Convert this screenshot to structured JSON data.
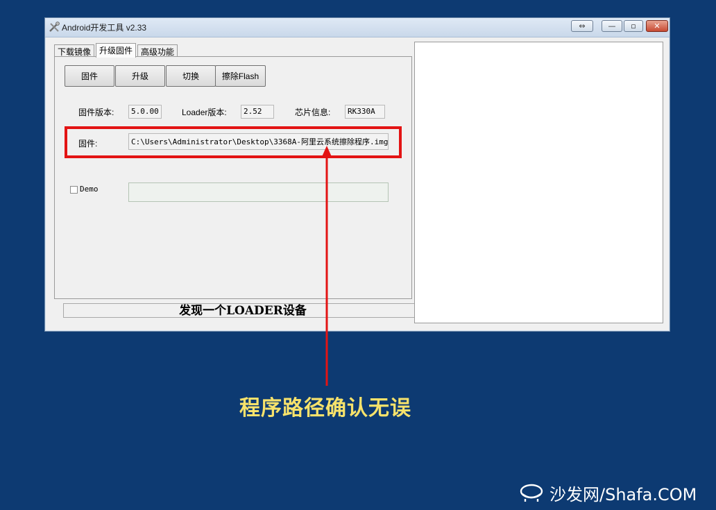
{
  "window": {
    "title": "Android开发工具 v2.33",
    "restore_glyph": "⇔",
    "minimize_glyph": "—",
    "maximize_glyph": "▫",
    "close_glyph": "✕"
  },
  "tabs": [
    {
      "label": "下载镜像"
    },
    {
      "label": "升级固件"
    },
    {
      "label": "高级功能"
    }
  ],
  "buttons": {
    "firmware": "固件",
    "upgrade": "升级",
    "switch": "切换",
    "erase_flash": "擦除Flash"
  },
  "info": {
    "firmware_version_label": "固件版本:",
    "firmware_version_value": "5.0.00",
    "loader_version_label": "Loader版本:",
    "loader_version_value": "2.52",
    "chip_info_label": "芯片信息:",
    "chip_info_value": "RK330A"
  },
  "firmware_path": {
    "label": "固件:",
    "value": "C:\\Users\\Administrator\\Desktop\\3368A-阿里云系统擦除程序.img"
  },
  "demo": {
    "label": "Demo",
    "checked": false
  },
  "status": {
    "text": "发现一个LOADER设备"
  },
  "annotation": {
    "caption": "程序路径确认无误",
    "color": "#e31414",
    "caption_color": "#f7e26b"
  },
  "watermark": {
    "text": "沙发网/Shafa.COM"
  }
}
